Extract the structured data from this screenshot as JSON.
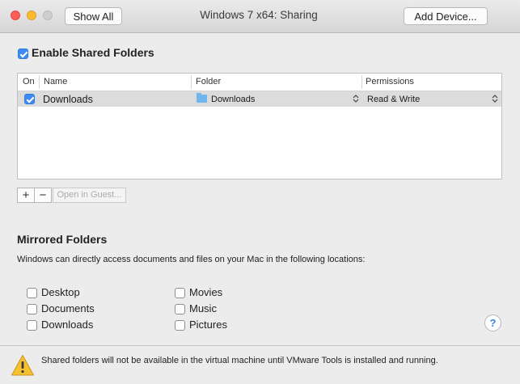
{
  "titlebar": {
    "title": "Windows 7 x64: Sharing",
    "show_all_label": "Show All",
    "add_device_label": "Add Device..."
  },
  "shared": {
    "enable_label": "Enable Shared Folders",
    "enable_checked": true,
    "columns": [
      "On",
      "Name",
      "Folder",
      "Permissions"
    ],
    "rows": [
      {
        "on": true,
        "name": "Downloads",
        "folder": "Downloads",
        "permissions": "Read & Write"
      }
    ],
    "add_symbol": "+",
    "remove_symbol": "−",
    "open_in_guest_label": "Open in Guest..."
  },
  "mirrored": {
    "title": "Mirrored Folders",
    "description": "Windows can directly access documents and files on your Mac in the following locations:",
    "options": [
      {
        "label": "Desktop",
        "checked": false
      },
      {
        "label": "Documents",
        "checked": false
      },
      {
        "label": "Downloads",
        "checked": false
      },
      {
        "label": "Movies",
        "checked": false
      },
      {
        "label": "Music",
        "checked": false
      },
      {
        "label": "Pictures",
        "checked": false
      }
    ]
  },
  "help": {
    "symbol": "?"
  },
  "warning": {
    "text": "Shared folders will not be available in the virtual machine until VMware Tools is installed and running."
  },
  "icons": {
    "close": "close-icon",
    "minimize": "minimize-icon",
    "zoom": "zoom-icon",
    "folder": "folder-icon",
    "warning": "warning-triangle-icon"
  },
  "colors": {
    "accent": "#3d8cf5",
    "row_selected": "#dcdcdc",
    "close": "#fc5f57",
    "minimize": "#fdbc2e",
    "warning": "#f5c12e"
  }
}
